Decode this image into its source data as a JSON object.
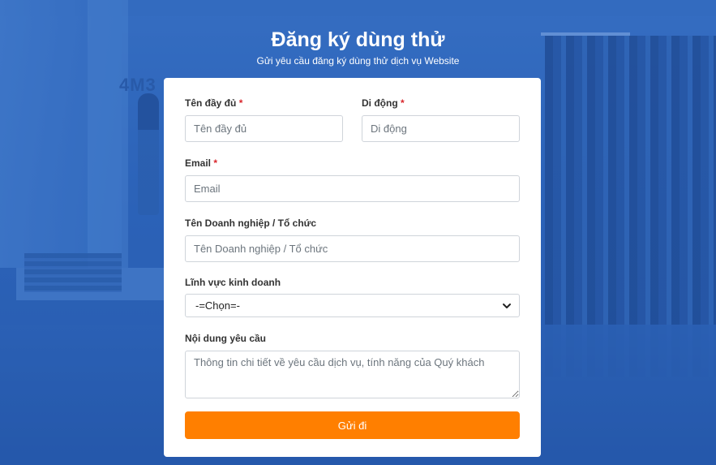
{
  "header": {
    "title": "Đăng ký dùng thử",
    "subtitle": "Gửi yêu cầu đăng ký dùng thử dịch vụ Website"
  },
  "background": {
    "store_logo": "4M3"
  },
  "form": {
    "full_name": {
      "label": "Tên đầy đủ",
      "required_mark": "*",
      "placeholder": "Tên đầy đủ",
      "value": ""
    },
    "mobile": {
      "label": "Di động",
      "required_mark": "*",
      "placeholder": "Di động",
      "value": ""
    },
    "email": {
      "label": "Email",
      "required_mark": "*",
      "placeholder": "Email",
      "value": ""
    },
    "company": {
      "label": "Tên Doanh nghiệp / Tổ chức",
      "placeholder": "Tên Doanh nghiệp / Tổ chức",
      "value": ""
    },
    "business_field": {
      "label": "Lĩnh vực kinh doanh",
      "selected": "-=Chọn=-"
    },
    "request": {
      "label": "Nội dung yêu cầu",
      "placeholder": "Thông tin chi tiết về yêu cầu dịch vụ, tính năng của Quý khách",
      "value": ""
    },
    "submit_label": "Gửi đi"
  },
  "colors": {
    "accent": "#ff7f00",
    "background_tint": "#2f64b8",
    "required": "#d9262c"
  },
  "icons": {
    "select_arrow": "chevron-down-icon"
  }
}
